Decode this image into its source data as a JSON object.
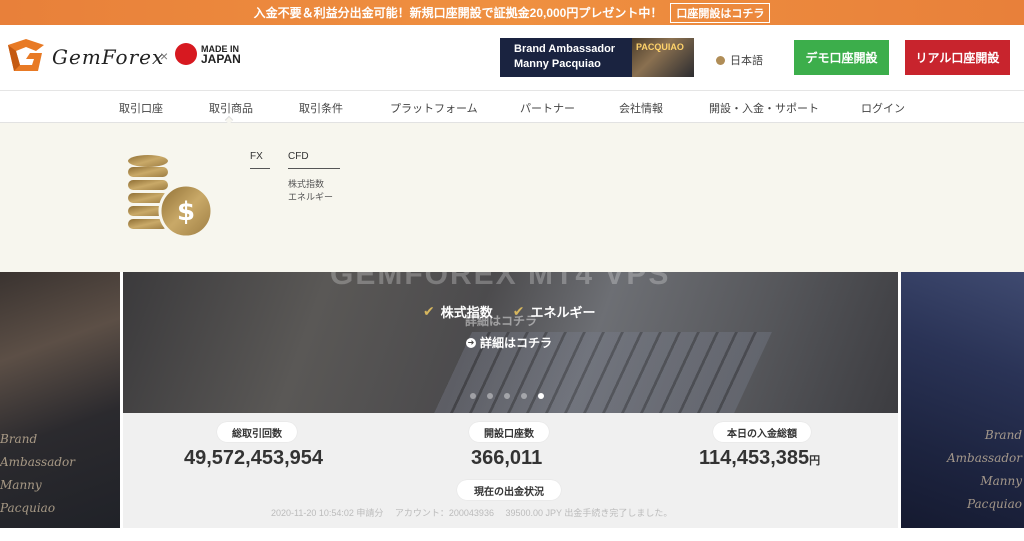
{
  "promo": {
    "text": "入金不要＆利益分出金可能！新規口座開設で証拠金20,000円プレゼント中！",
    "cta": "口座開設はコチラ"
  },
  "header": {
    "logo_text": "GemForex",
    "logo_times": "×",
    "made_in_line1": "MADE IN",
    "made_in_line2": "JAPAN",
    "ambassador_line1": "Brand Ambassador",
    "ambassador_line2": "Manny Pacquiao",
    "ambassador_photo_label": "PACQUIAO",
    "language": "日本語",
    "demo_button": "デモ口座開設",
    "real_button": "リアル口座開設"
  },
  "nav": {
    "items": [
      "取引口座",
      "取引商品",
      "取引条件",
      "プラットフォーム",
      "パートナー",
      "会社情報",
      "開設・入金・サポート",
      "ログイン"
    ]
  },
  "dropdown": {
    "col1_head": "FX",
    "col2_head": "CFD",
    "col2_items": [
      "株式指数",
      "エネルギー"
    ]
  },
  "hero": {
    "faded_title": "GEMFOREX MT4 VPS",
    "tags": [
      "株式指数",
      "エネルギー"
    ],
    "ghost_link": "詳細はコチラ",
    "detail_link": "詳細はコチラ",
    "slide_count": 5,
    "active_slide": 5,
    "side_left_lines": [
      "Brand",
      "Ambassador",
      "Manny",
      "Pacquiao"
    ],
    "side_right_lines": [
      "Brand",
      "Ambassador",
      "Manny",
      "Pacquiao"
    ]
  },
  "stats": {
    "total_trades_label": "総取引回数",
    "total_trades_value": "49,572,453,954",
    "accounts_label": "開設口座数",
    "accounts_value": "366,011",
    "deposits_label": "本日の入金総額",
    "deposits_value": "114,453,385",
    "deposits_unit": "円",
    "withdraw_label": "現在の出金状況",
    "ticker": "2020-11-20 10:54:02 申請分　 アカウント：200043936　 39500.00 JPY 出金手続き完了しました。"
  },
  "colors": {
    "promo": "#ec8a3d",
    "demo_green": "#3cae4b",
    "real_red": "#c8242d",
    "gold": "#b08d57"
  }
}
